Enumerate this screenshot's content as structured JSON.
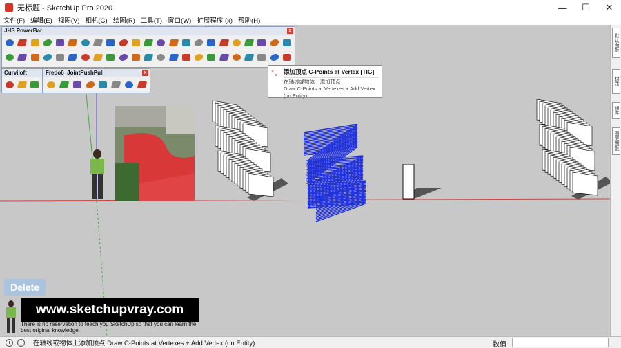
{
  "window": {
    "title": "无标题 - SketchUp Pro 2020",
    "controls": {
      "minimize": "—",
      "maximize": "☐",
      "close": "✕"
    }
  },
  "menu": [
    {
      "label": "文件(F)"
    },
    {
      "label": "编辑(E)"
    },
    {
      "label": "视图(V)"
    },
    {
      "label": "相机(C)"
    },
    {
      "label": "绘图(R)"
    },
    {
      "label": "工具(T)"
    },
    {
      "label": "窗口(W)"
    },
    {
      "label": "扩展程序 (x)"
    },
    {
      "label": "帮助(H)"
    }
  ],
  "toolbars": {
    "jhs": {
      "title": "JHS PowerBar",
      "close": "x"
    },
    "curviloft": {
      "title": "Curviloft",
      "close": "x"
    },
    "fredo": {
      "title": "Fredo6_JointPushPull",
      "close": "x"
    }
  },
  "tooltip": {
    "title": "添加顶点 C-Points at Vertex [TIG]",
    "desc_cn": "在轴线或物体上添加顶点",
    "desc_en": "Draw C-Points at Vertexes + Add Vertex (on Entity)"
  },
  "tray_tabs": [
    {
      "label": "默认面板"
    },
    {
      "label": "材质"
    },
    {
      "label": "组件"
    },
    {
      "label": "图层面板"
    }
  ],
  "overlays": {
    "delete_label": "Delete",
    "watermark": "www.sketchupvray.com",
    "caption": "There is no reservation to teach you SketchUp so that you can learn the best original knowledge."
  },
  "statusbar": {
    "info_icon": "i",
    "text": "在轴线或物体上添加顶点 Draw C-Points at Vertexes + Add Vertex (on Entity)",
    "measure_label": "数值"
  },
  "colors": {
    "viewport_bg": "#c8c8c8",
    "red_axis": "#cc3333",
    "green_axis": "#33aa33",
    "blue_axis": "#3333cc",
    "zigzag": "#2233dd"
  }
}
